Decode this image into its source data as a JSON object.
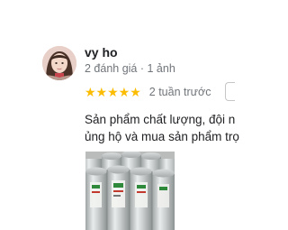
{
  "reviewer": {
    "name": "vy ho",
    "meta": "2 đánh giá · 1 ảnh"
  },
  "rating": {
    "value": 5,
    "max": 5,
    "stars_text": "★★★★★",
    "time": "2 tuần trước",
    "star_color": "#fbbc04"
  },
  "review": {
    "line1": "Sản phẩm chất lượng, đội n",
    "line2": "ủng hộ và mua sản phẩm trọ"
  },
  "photo": {
    "icon": "review-photo"
  }
}
